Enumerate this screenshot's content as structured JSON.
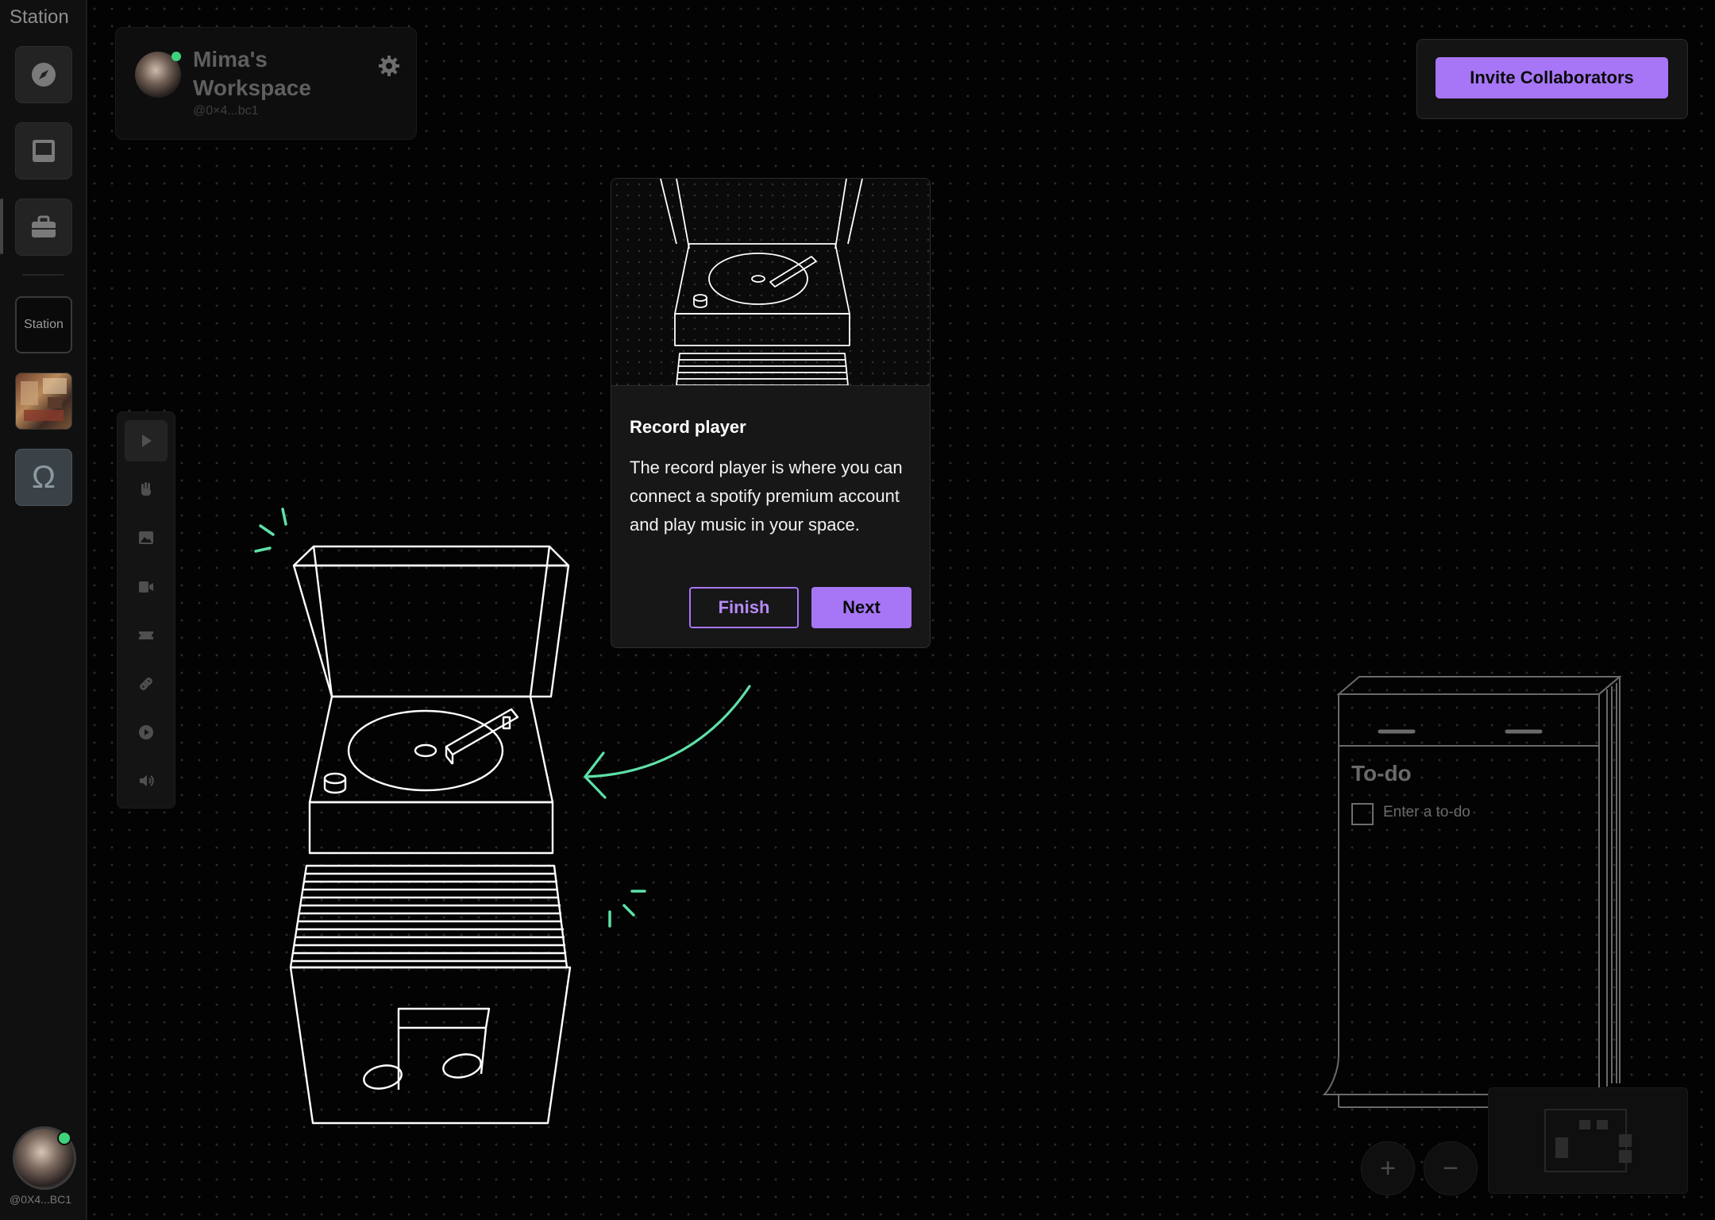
{
  "app": {
    "name": "Station"
  },
  "rail": {
    "title": "Station",
    "items": [
      {
        "icon": "compass-icon"
      },
      {
        "icon": "inbox-icon"
      },
      {
        "icon": "briefcase-icon"
      }
    ],
    "station_label": "Station",
    "omega_glyph": "Ω",
    "user_handle": "@0X4...BC1"
  },
  "workspace": {
    "name": "Mima's Workspace",
    "handle": "@0×4...bc1",
    "status_color": "#3ed27c"
  },
  "header": {
    "invite_label": "Invite Collaborators"
  },
  "toolbar": {
    "tools": [
      {
        "icon": "cursor-icon",
        "active": true
      },
      {
        "icon": "hand-icon"
      },
      {
        "icon": "image-icon"
      },
      {
        "icon": "video-icon"
      },
      {
        "icon": "ticket-icon"
      },
      {
        "icon": "link-icon"
      },
      {
        "icon": "play-icon"
      },
      {
        "icon": "speaker-icon"
      }
    ]
  },
  "tour": {
    "title": "Record player",
    "body": "The record player is where you can connect a spotify premium account and play music in your space.",
    "finish_label": "Finish",
    "next_label": "Next"
  },
  "todo": {
    "title": "To-do",
    "placeholder": "Enter a to-do"
  },
  "zoom": {
    "in_label": "+",
    "out_label": "−"
  },
  "colors": {
    "accent": "#a776f6",
    "highlight": "#5ee0a8",
    "background": "#000000"
  }
}
